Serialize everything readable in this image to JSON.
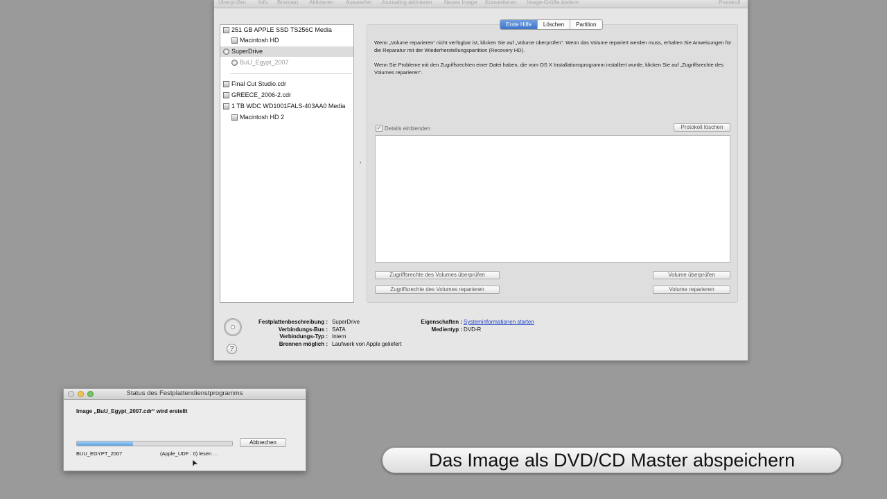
{
  "toolbar": {
    "items": [
      "Überprüfen",
      "Info",
      "Brennen",
      "Aktivieren",
      "Auswerfen",
      "Journaling aktivieren",
      "Neues Image",
      "Konvertieren",
      "Image-Größe ändern"
    ],
    "right": "Protokoll"
  },
  "sidebar": {
    "items": [
      {
        "label": "251 GB APPLE SSD TS256C Media",
        "icon": "hard-disk-icon"
      },
      {
        "label": "Macintosh HD",
        "icon": "volume-icon"
      },
      {
        "label": "SuperDrive",
        "icon": "optical-drive-icon"
      },
      {
        "label": "BuU_Egypt_2007",
        "icon": "disc-icon"
      },
      {
        "label": "Final Cut Studio.cdr",
        "icon": "image-file-icon"
      },
      {
        "label": "GREECE_2006-2.cdr",
        "icon": "image-file-icon"
      },
      {
        "label": "1 TB WDC WD1001FALS-403AA0 Media",
        "icon": "hard-disk-icon"
      },
      {
        "label": "Macintosh HD 2",
        "icon": "volume-icon"
      }
    ]
  },
  "tabs": [
    "Erste Hilfe",
    "Löschen",
    "Partition"
  ],
  "first_aid": {
    "para1": "Wenn „Volume reparieren“ nicht verfügbar ist, klicken Sie auf „Volume überprüfen“. Wenn das Volume repariert werden muss, erhalten Sie Anweisungen für die Reparatur mit der Wiederherstellungspartition (Recovery HD).",
    "para2": "Wenn Sie Probleme mit den Zugriffsrechten einer Datei haben, die vom OS X Installationsprogramm installiert wurde, klicken Sie auf „Zugriffsrechte des Volumes reparieren“.",
    "details_label": "Details einblenden",
    "clear_log": "Protokoll löschen",
    "verify_permissions": "Zugriffsrechte des Volumes überprüfen",
    "repair_permissions": "Zugriffsrechte des Volumes reparieren",
    "verify_volume": "Volume überprüfen",
    "repair_volume": "Volume reparieren"
  },
  "info": {
    "labels_left": [
      "Festplattenbeschreibung :",
      "Verbindungs-Bus :",
      "Verbindungs-Typ :",
      "Brennen möglich :"
    ],
    "values_left": [
      "SuperDrive",
      "SATA",
      "Intern",
      "Laufwerk von Apple geliefert"
    ],
    "labels_right": [
      "Eigenschaften :",
      "Medientyp :"
    ],
    "values_right": [
      "Systeminformationen starten",
      "DVD-R"
    ],
    "help": "?"
  },
  "status_window": {
    "title": "Status des Festplattendienstprogramms",
    "message": "Image „BuU_Egypt_2007.cdr“ wird erstellt",
    "cancel": "Abbrechen",
    "volume_name": "BUU_EGYPT_2007",
    "detail": "(Apple_UDF : 0) lesen …",
    "progress": 0.36
  },
  "caption": "Das Image als DVD/CD Master abspeichern",
  "colors": {
    "accent": "#3d74c9",
    "link": "#2445c9",
    "progress": "#5aa0e3"
  }
}
